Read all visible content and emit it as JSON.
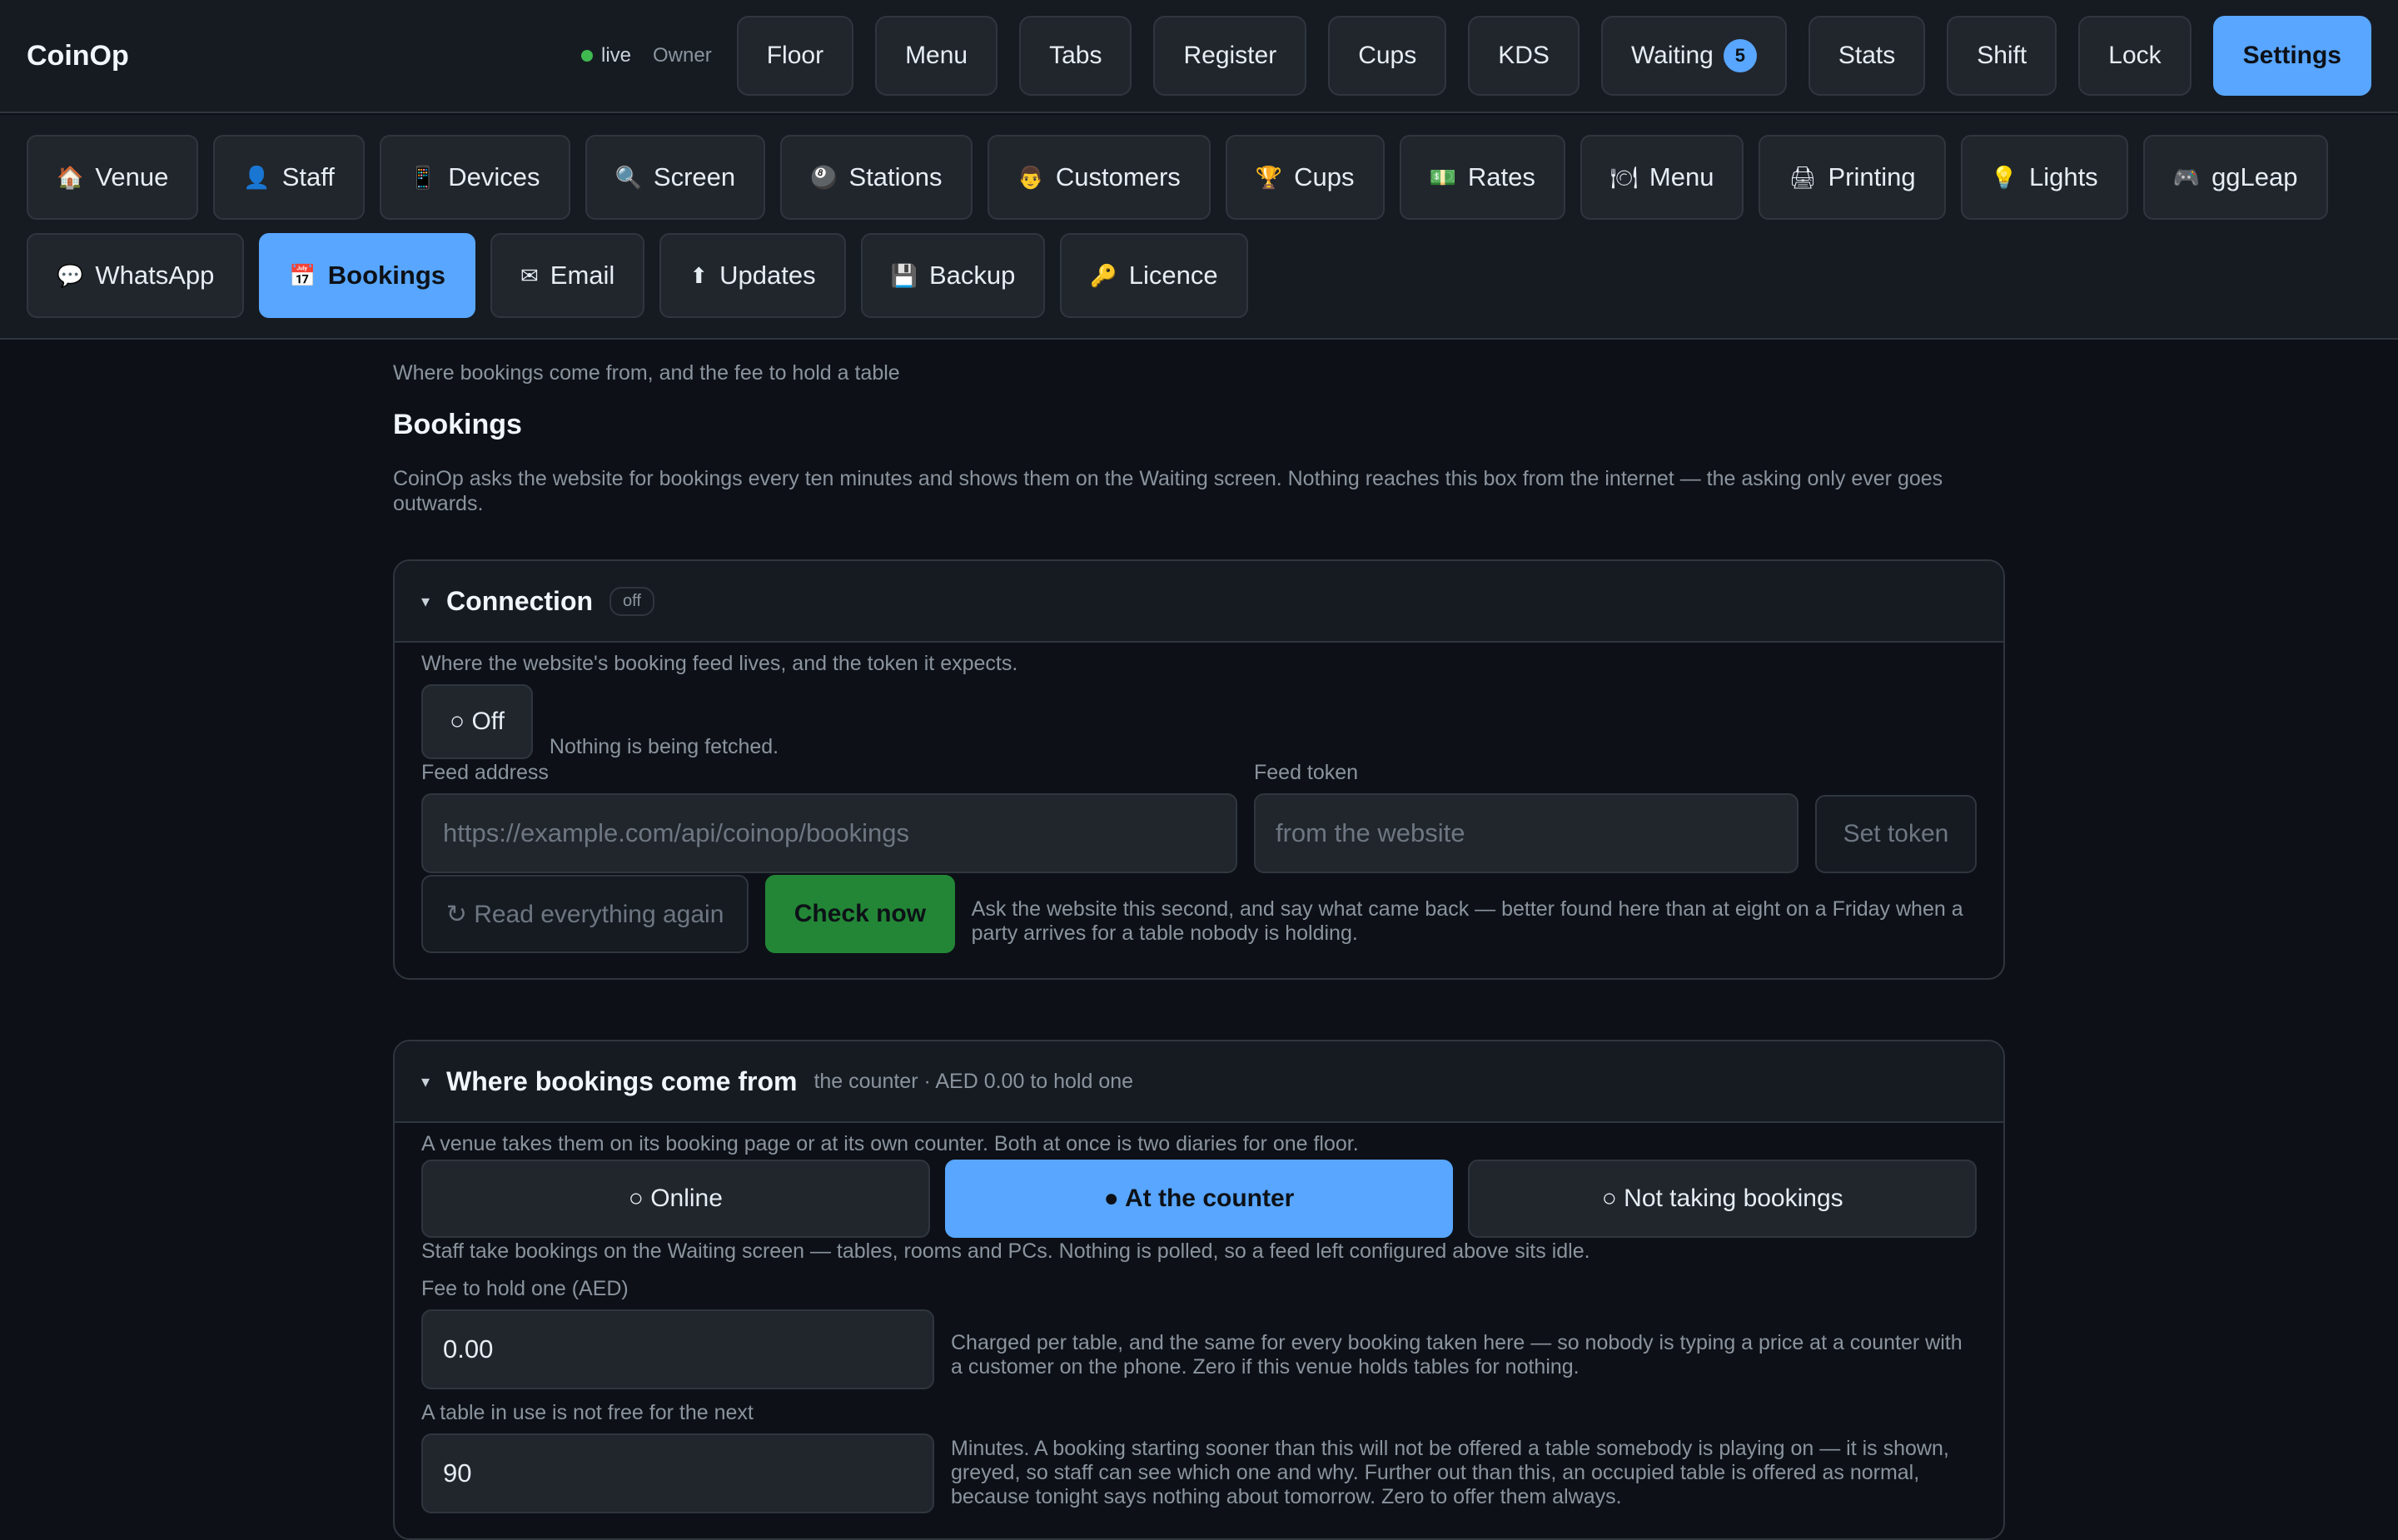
{
  "app": {
    "title": "CoinOp",
    "status": "live",
    "role": "Owner"
  },
  "topnav": [
    {
      "label": "Floor"
    },
    {
      "label": "Menu"
    },
    {
      "label": "Tabs"
    },
    {
      "label": "Register"
    },
    {
      "label": "Cups"
    },
    {
      "label": "KDS"
    },
    {
      "label": "Waiting",
      "badge": "5"
    },
    {
      "label": "Stats"
    },
    {
      "label": "Shift"
    },
    {
      "label": "Lock"
    },
    {
      "label": "Settings",
      "active": true
    }
  ],
  "tabs": [
    {
      "label": "Venue",
      "icon": "🏠"
    },
    {
      "label": "Staff",
      "icon": "👤"
    },
    {
      "label": "Devices",
      "icon": "📱"
    },
    {
      "label": "Screen",
      "icon": "🔍"
    },
    {
      "label": "Stations",
      "icon": "🎱"
    },
    {
      "label": "Customers",
      "icon": "👨"
    },
    {
      "label": "Cups",
      "icon": "🏆"
    },
    {
      "label": "Rates",
      "icon": "💵"
    },
    {
      "label": "Menu",
      "icon": "🍽"
    },
    {
      "label": "Printing",
      "icon": "🖨"
    },
    {
      "label": "Lights",
      "icon": "💡"
    },
    {
      "label": "ggLeap",
      "icon": "🎮"
    },
    {
      "label": "WhatsApp",
      "icon": "💬"
    },
    {
      "label": "Bookings",
      "icon": "📅",
      "active": true
    },
    {
      "label": "Email",
      "icon": "✉"
    },
    {
      "label": "Updates",
      "icon": "⬆"
    },
    {
      "label": "Backup",
      "icon": "💾"
    },
    {
      "label": "Licence",
      "icon": "🔑"
    }
  ],
  "page": {
    "crumb": "Where bookings come from, and the fee to hold a table",
    "title": "Bookings",
    "intro": "CoinOp asks the website for bookings every ten minutes and shows them on the Waiting screen. Nothing reaches this box from the internet — the asking only ever goes outwards."
  },
  "connection": {
    "caret": "▾",
    "title": "Connection",
    "pill": "off",
    "desc": "Where the website's booking feed lives, and the token it expects.",
    "toggle_label": "○ Off",
    "toggle_status": "Nothing is being fetched.",
    "feed_address_label": "Feed address",
    "feed_address_placeholder": "https://example.com/api/coinop/bookings",
    "feed_token_label": "Feed token",
    "feed_token_placeholder": "from the website",
    "set_token": "Set token",
    "read_again": "↻ Read everything again",
    "check_now": "Check now",
    "check_help": "Ask the website this second, and say what came back — better found here than at eight on a Friday when a party arrives for a table nobody is holding."
  },
  "source": {
    "caret": "▾",
    "title": "Where bookings come from",
    "subtitle": "the counter · AED 0.00 to hold one",
    "desc": "A venue takes them on its booking page or at its own counter. Both at once is two diaries for one floor.",
    "options": [
      {
        "label": "○ Online"
      },
      {
        "label": "● At the counter",
        "active": true
      },
      {
        "label": "○ Not taking bookings"
      }
    ],
    "option_help": "Staff take bookings on the Waiting screen — tables, rooms and PCs. Nothing is polled, so a feed left configured above sits idle.",
    "fee_label": "Fee to hold one (AED)",
    "fee_value": "0.00",
    "fee_help": "Charged per table, and the same for every booking taken here — so nobody is typing a price at a counter with a customer on the phone. Zero if this venue holds tables for nothing.",
    "busy_label": "A table in use is not free for the next",
    "busy_value": "90",
    "busy_help": "Minutes. A booking starting sooner than this will not be offered a table somebody is playing on — it is shown, greyed, so staff can see which one and why. Further out than this, an occupied table is offered as normal, because tonight says nothing about tomorrow. Zero to offer them always."
  }
}
